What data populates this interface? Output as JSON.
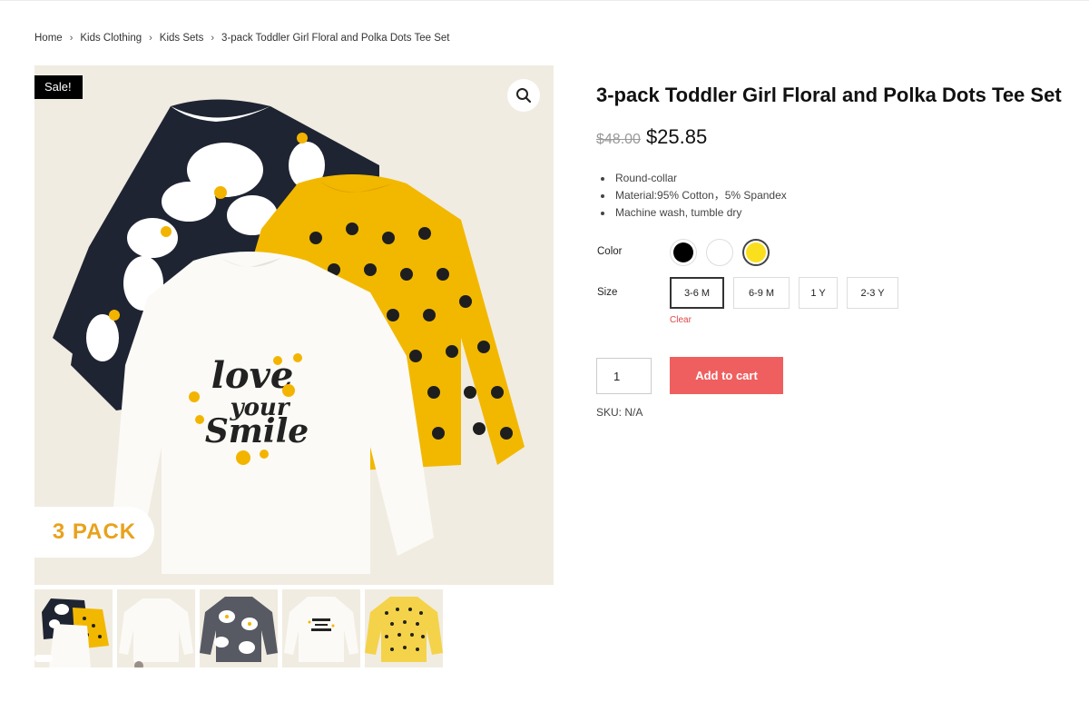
{
  "breadcrumb": [
    "Home",
    "Kids Clothing",
    "Kids Sets",
    "3-pack Toddler Girl Floral and Polka Dots Tee Set"
  ],
  "gallery": {
    "sale_badge": "Sale!",
    "pack_label": "3 PACK",
    "zoom_icon": "search-icon",
    "thumbnails": [
      {
        "name": "thumbnail-set",
        "colors": [
          "#1f2433",
          "#f2b800",
          "#ffffff"
        ]
      },
      {
        "name": "thumbnail-white-tee",
        "colors": [
          "#f5f2ec"
        ]
      },
      {
        "name": "thumbnail-floral-tee",
        "colors": [
          "#575a63",
          "#ffffff"
        ]
      },
      {
        "name": "thumbnail-print-tee",
        "colors": [
          "#f5f2ec",
          "#222222"
        ]
      },
      {
        "name": "thumbnail-polka-tee",
        "colors": [
          "#f4d34a",
          "#222222"
        ]
      }
    ]
  },
  "product": {
    "title": "3-pack Toddler Girl Floral and Polka Dots Tee Set",
    "old_price": "$48.00",
    "price": "$25.85",
    "features": [
      "Round-collar",
      "Material:95% Cotton，5% Spandex",
      "Machine wash, tumble dry"
    ]
  },
  "options": {
    "color_label": "Color",
    "colors": [
      {
        "name": "black",
        "hex": "#000000",
        "selected": false
      },
      {
        "name": "white",
        "hex": "#ffffff",
        "selected": false
      },
      {
        "name": "yellow",
        "hex": "#f9df1d",
        "selected": true
      }
    ],
    "size_label": "Size",
    "sizes": [
      {
        "label": "3-6 M",
        "selected": true
      },
      {
        "label": "6-9 M",
        "selected": false
      },
      {
        "label": "1 Y",
        "selected": false
      },
      {
        "label": "2-3 Y",
        "selected": false
      }
    ],
    "clear_label": "Clear"
  },
  "cart": {
    "quantity": "1",
    "add_label": "Add to cart"
  },
  "sku": "SKU: N/A",
  "colors": {
    "accent": "#ef5f5f",
    "sale_badge_bg": "#000000",
    "pack_text": "#e8a21c",
    "clear_link": "#e04848"
  }
}
